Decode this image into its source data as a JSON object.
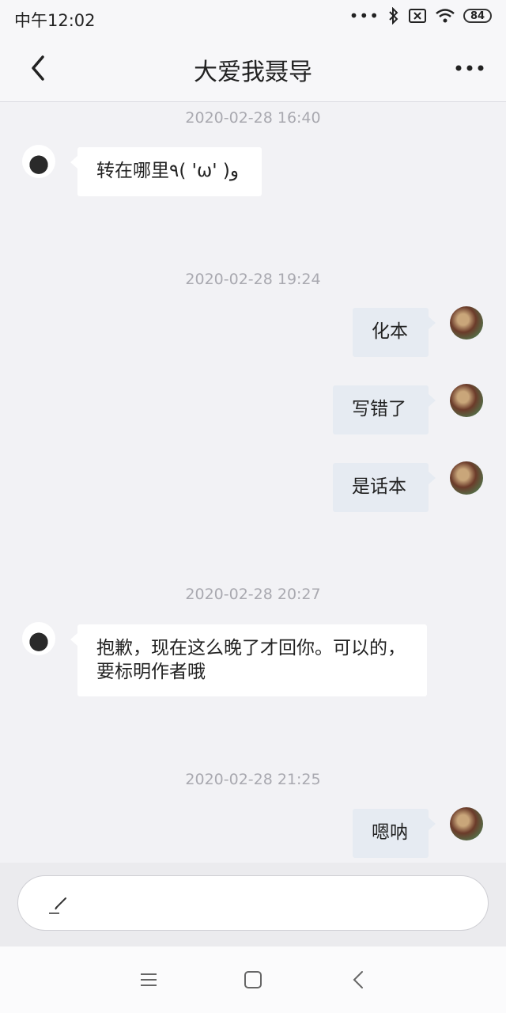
{
  "status_bar": {
    "time": "中午12:02",
    "battery": "84"
  },
  "header": {
    "title": "大爱我聂导"
  },
  "messages": [
    {
      "type": "timestamp",
      "text": "2020-02-28 16:40"
    },
    {
      "type": "message",
      "sender": "other",
      "text": "转在哪里٩( 'ω' )و"
    },
    {
      "type": "timestamp",
      "text": "2020-02-28 19:24"
    },
    {
      "type": "message",
      "sender": "self",
      "text": "化本"
    },
    {
      "type": "message",
      "sender": "self",
      "text": "写错了"
    },
    {
      "type": "message",
      "sender": "self",
      "text": "是话本"
    },
    {
      "type": "timestamp",
      "text": "2020-02-28 20:27"
    },
    {
      "type": "message",
      "sender": "other",
      "text": "抱歉，现在这么晚了才回你。可以的，要标明作者哦"
    },
    {
      "type": "timestamp",
      "text": "2020-02-28 21:25"
    },
    {
      "type": "message",
      "sender": "self",
      "text": "嗯呐"
    }
  ],
  "input": {
    "icon": "pen-icon",
    "value": ""
  },
  "icons": {
    "back": "back-arrow-icon",
    "more": "more-dots-icon",
    "bluetooth": "bluetooth-icon",
    "sim": "no-sim-icon",
    "wifi": "wifi-icon",
    "nav_menu": "menu-icon",
    "nav_home": "home-icon",
    "nav_back": "nav-back-icon"
  },
  "colors": {
    "background": "#f2f2f5",
    "self_bubble": "#e6ebf2",
    "other_bubble": "#ffffff",
    "timestamp": "#a9a9b0"
  }
}
